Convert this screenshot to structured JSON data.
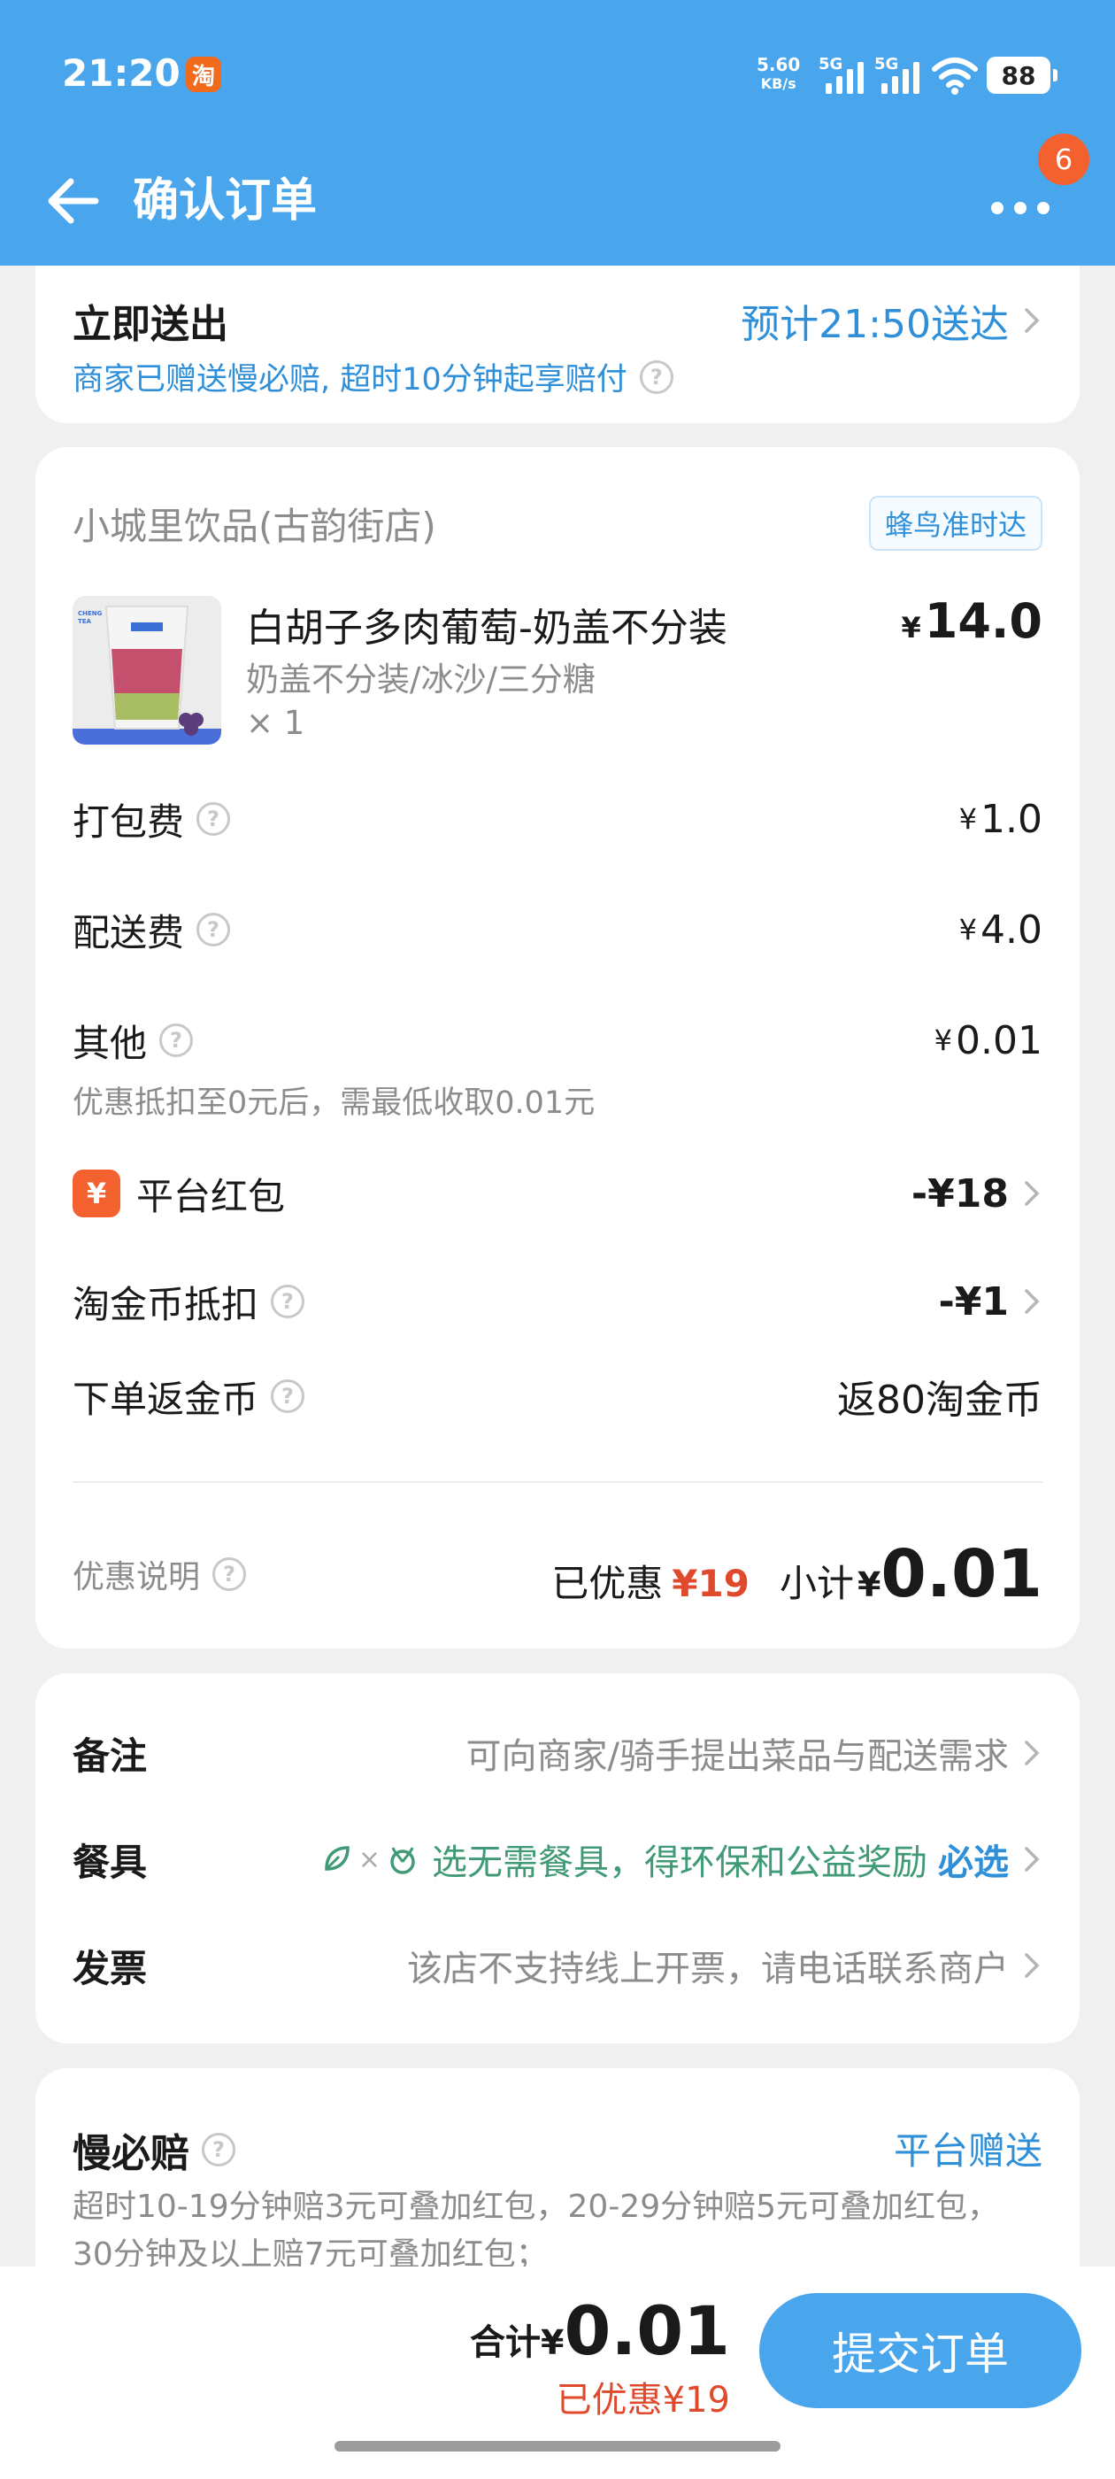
{
  "status_bar": {
    "time": "21:20",
    "app_badge": "淘",
    "net_speed_value": "5.60",
    "net_speed_unit": "KB/s",
    "sim1": "5G",
    "sim2": "5G",
    "battery": "88"
  },
  "header": {
    "title": "确认订单",
    "notification_count": "6",
    "accent_color": "#4aa6ec"
  },
  "delivery": {
    "title": "立即送出",
    "eta": "预计21:50送达",
    "note": "商家已赠送慢必赔, 超时10分钟起享赔付"
  },
  "order": {
    "shop_name": "小城里饮品(古韵街店)",
    "shop_tag": "蜂鸟准时达",
    "product": {
      "name": "白胡子多肉葡萄-奶盖不分装",
      "spec": "奶盖不分装/冰沙/三分糖",
      "qty": "× 1",
      "price": "14.0",
      "image_brand": "CHENG TEA"
    },
    "fees": [
      {
        "label": "打包费",
        "value": "1.0"
      },
      {
        "label": "配送费",
        "value": "4.0"
      },
      {
        "label": "其他",
        "value": "0.01"
      }
    ],
    "other_note": "优惠抵扣至0元后，需最低收取0.01元",
    "red_packet": {
      "icon": "¥",
      "label": "平台红包",
      "value": "-¥18"
    },
    "coin_deduct": {
      "label": "淘金币抵扣",
      "value": "-¥1"
    },
    "coin_return": {
      "label": "下单返金币",
      "value": "返80淘金币"
    },
    "summary": {
      "discount_label": "优惠说明",
      "saved_label": "已优惠",
      "saved_value": "¥19",
      "subtotal_label": "小计",
      "subtotal_currency": "¥",
      "subtotal_value": "0.01"
    },
    "currency": "¥"
  },
  "remarks": {
    "note_label": "备注",
    "note_placeholder": "可向商家/骑手提出菜品与配送需求",
    "tableware_label": "餐具",
    "tableware_text": "选无需餐具，得环保和公益奖励",
    "tableware_action": "必选",
    "invoice_label": "发票",
    "invoice_text": "该店不支持线上开票，请电话联系商户"
  },
  "guarantee": {
    "title": "慢必赔",
    "tag": "平台赠送",
    "desc": "超时10-19分钟赔3元可叠加红包，20-29分钟赔5元可叠加红包，30分钟及以上赔7元可叠加红包；"
  },
  "bottom": {
    "total_label": "合计",
    "currency": "¥",
    "total_value": "0.01",
    "saved": "已优惠¥19",
    "submit": "提交订单"
  }
}
